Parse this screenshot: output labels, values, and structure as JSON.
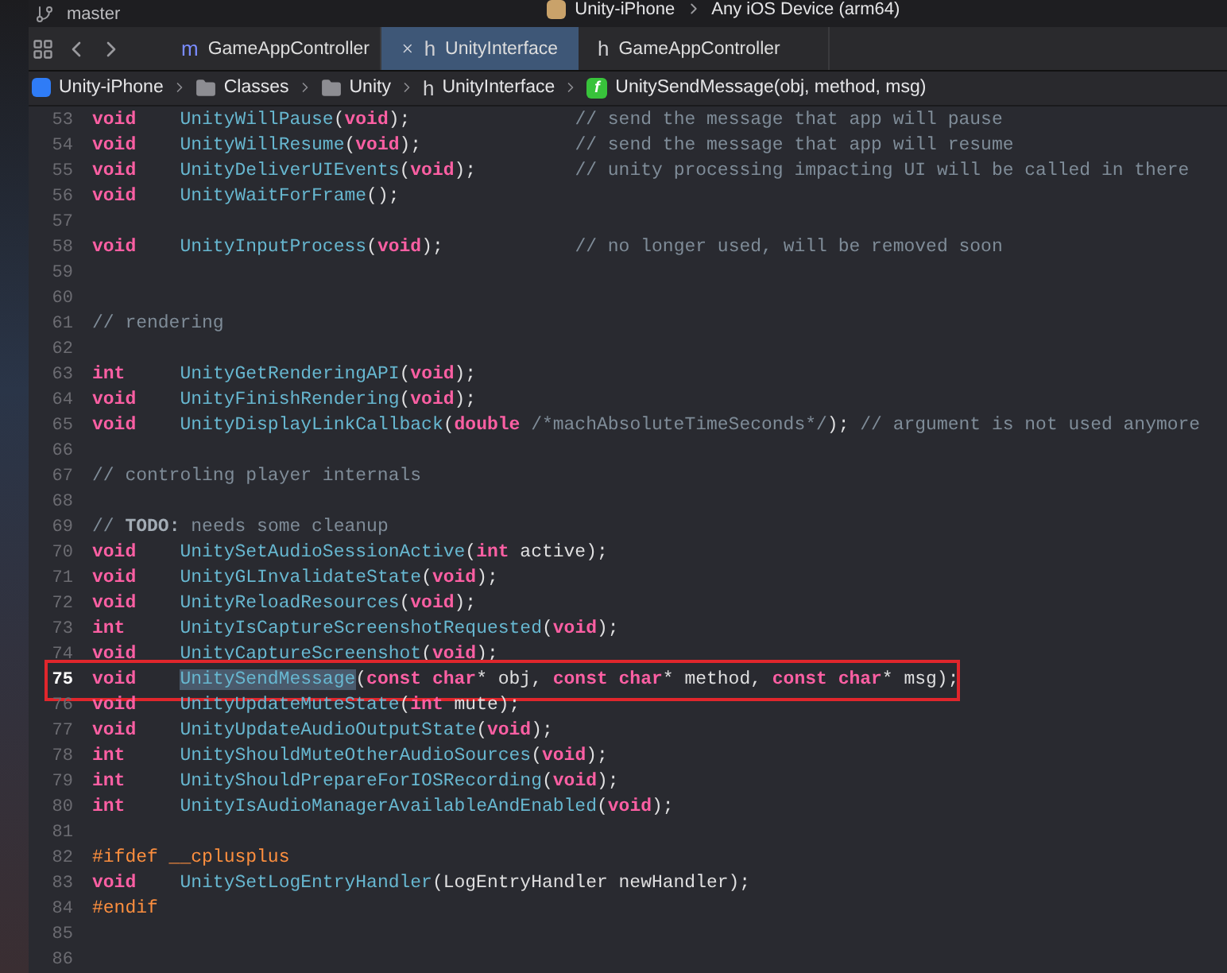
{
  "toolbar": {
    "branch": "master",
    "scheme": "Unity-iPhone",
    "destination": "Any iOS Device (arm64)"
  },
  "tabs": [
    {
      "kind": "source",
      "glyph": "m",
      "label": "GameAppController",
      "selected": false
    },
    {
      "kind": "header",
      "glyph": "h",
      "label": "UnityInterface",
      "selected": true
    },
    {
      "kind": "header",
      "glyph": "h",
      "label": "GameAppController",
      "selected": false
    }
  ],
  "breadcrumbs": [
    {
      "kind": "app",
      "label": "Unity-iPhone"
    },
    {
      "kind": "folder",
      "label": "Classes"
    },
    {
      "kind": "folder",
      "label": "Unity"
    },
    {
      "kind": "header",
      "glyph": "h",
      "label": "UnityInterface"
    },
    {
      "kind": "function",
      "glyph": "f",
      "label": "UnitySendMessage(obj, method, msg)"
    }
  ],
  "lines": [
    {
      "number": "53",
      "highlighted": false,
      "tokens": [
        {
          "kind": "keyword",
          "text": "void"
        },
        {
          "kind": "function",
          "text": "UnityWillPause"
        },
        {
          "kind": "plain",
          "text": "("
        },
        {
          "kind": "keyword",
          "text": "void"
        },
        {
          "kind": "plain",
          "text": ");"
        },
        {
          "kind": "note",
          "text": "// send the message that app will pause"
        }
      ]
    },
    {
      "number": "54",
      "highlighted": false,
      "tokens": [
        {
          "kind": "keyword",
          "text": "void"
        },
        {
          "kind": "function",
          "text": "UnityWillResume"
        },
        {
          "kind": "plain",
          "text": "("
        },
        {
          "kind": "keyword",
          "text": "void"
        },
        {
          "kind": "plain",
          "text": ");"
        },
        {
          "kind": "note",
          "text": "// send the message that app will resume"
        }
      ]
    },
    {
      "number": "55",
      "highlighted": false,
      "tokens": [
        {
          "kind": "keyword",
          "text": "void"
        },
        {
          "kind": "function",
          "text": "UnityDeliverUIEvents"
        },
        {
          "kind": "plain",
          "text": "("
        },
        {
          "kind": "keyword",
          "text": "void"
        },
        {
          "kind": "plain",
          "text": ");"
        },
        {
          "kind": "note",
          "text": "// unity processing impacting UI will be called in there"
        }
      ]
    },
    {
      "number": "56",
      "highlighted": false,
      "tokens": [
        {
          "kind": "keyword",
          "text": "void"
        },
        {
          "kind": "function",
          "text": "UnityWaitForFrame"
        },
        {
          "kind": "plain",
          "text": "();"
        }
      ]
    },
    {
      "number": "57",
      "highlighted": false
    },
    {
      "number": "58",
      "highlighted": false,
      "tokens": [
        {
          "kind": "keyword",
          "text": "void"
        },
        {
          "kind": "function",
          "text": "UnityInputProcess"
        },
        {
          "kind": "plain",
          "text": "("
        },
        {
          "kind": "keyword",
          "text": "void"
        },
        {
          "kind": "plain",
          "text": ");"
        },
        {
          "kind": "note",
          "text": "// no longer used, will be removed soon"
        }
      ]
    },
    {
      "number": "59",
      "highlighted": false
    },
    {
      "number": "60",
      "highlighted": false
    },
    {
      "number": "61",
      "highlighted": false,
      "tokens": [
        {
          "kind": "comment",
          "text": "// rendering"
        }
      ]
    },
    {
      "number": "62",
      "highlighted": false
    },
    {
      "number": "63",
      "highlighted": false,
      "tokens": [
        {
          "kind": "keyword",
          "text": "int"
        },
        {
          "kind": "function",
          "text": "UnityGetRenderingAPI"
        },
        {
          "kind": "plain",
          "text": "("
        },
        {
          "kind": "keyword",
          "text": "void"
        },
        {
          "kind": "plain",
          "text": ");"
        }
      ]
    },
    {
      "number": "64",
      "highlighted": false,
      "tokens": [
        {
          "kind": "keyword",
          "text": "void"
        },
        {
          "kind": "function",
          "text": "UnityFinishRendering"
        },
        {
          "kind": "plain",
          "text": "("
        },
        {
          "kind": "keyword",
          "text": "void"
        },
        {
          "kind": "plain",
          "text": ");"
        }
      ]
    },
    {
      "number": "65",
      "highlighted": false,
      "tokens": [
        {
          "kind": "keyword",
          "text": "void"
        },
        {
          "kind": "function",
          "text": "UnityDisplayLinkCallback"
        },
        {
          "kind": "plain",
          "text": "("
        },
        {
          "kind": "keyword",
          "text": "double "
        },
        {
          "kind": "comment",
          "text": "/*machAbsoluteTimeSeconds*/"
        },
        {
          "kind": "plain",
          "text": ");"
        },
        {
          "kind": "note",
          "text": "// argument is not used anymore"
        }
      ]
    },
    {
      "number": "66",
      "highlighted": false
    },
    {
      "number": "67",
      "highlighted": false,
      "tokens": [
        {
          "kind": "comment",
          "text": "// controling player internals"
        }
      ]
    },
    {
      "number": "68",
      "highlighted": false
    },
    {
      "number": "69",
      "highlighted": false,
      "tokens": [
        {
          "kind": "comment",
          "text": "// "
        },
        {
          "kind": "tag",
          "text": "TODO:"
        },
        {
          "kind": "comment",
          "text": " needs some cleanup"
        }
      ]
    },
    {
      "number": "70",
      "highlighted": false,
      "tokens": [
        {
          "kind": "keyword",
          "text": "void"
        },
        {
          "kind": "function",
          "text": "UnitySetAudioSessionActive"
        },
        {
          "kind": "plain",
          "text": "("
        },
        {
          "kind": "keyword",
          "text": "int "
        },
        {
          "kind": "plain",
          "text": "active);"
        }
      ]
    },
    {
      "number": "71",
      "highlighted": false,
      "tokens": [
        {
          "kind": "keyword",
          "text": "void"
        },
        {
          "kind": "function",
          "text": "UnityGLInvalidateState"
        },
        {
          "kind": "plain",
          "text": "("
        },
        {
          "kind": "keyword",
          "text": "void"
        },
        {
          "kind": "plain",
          "text": ");"
        }
      ]
    },
    {
      "number": "72",
      "highlighted": false,
      "tokens": [
        {
          "kind": "keyword",
          "text": "void"
        },
        {
          "kind": "function",
          "text": "UnityReloadResources"
        },
        {
          "kind": "plain",
          "text": "("
        },
        {
          "kind": "keyword",
          "text": "void"
        },
        {
          "kind": "plain",
          "text": ");"
        }
      ]
    },
    {
      "number": "73",
      "highlighted": false,
      "tokens": [
        {
          "kind": "keyword",
          "text": "int"
        },
        {
          "kind": "function",
          "text": "UnityIsCaptureScreenshotRequested"
        },
        {
          "kind": "plain",
          "text": "("
        },
        {
          "kind": "keyword",
          "text": "void"
        },
        {
          "kind": "plain",
          "text": ");"
        }
      ]
    },
    {
      "number": "74",
      "highlighted": false,
      "tokens": [
        {
          "kind": "keyword",
          "text": "void"
        },
        {
          "kind": "function",
          "text": "UnityCaptureScreenshot"
        },
        {
          "kind": "plain",
          "text": "("
        },
        {
          "kind": "keyword",
          "text": "void"
        },
        {
          "kind": "plain",
          "text": ");"
        }
      ]
    },
    {
      "number": "75",
      "highlighted": true,
      "tokens": [
        {
          "kind": "keyword",
          "text": "void"
        },
        {
          "kind": "selection",
          "text": "UnitySendMessage"
        },
        {
          "kind": "plain",
          "text": "("
        },
        {
          "kind": "keyword",
          "text": "const char"
        },
        {
          "kind": "plain",
          "text": "* obj, "
        },
        {
          "kind": "keyword",
          "text": "const char"
        },
        {
          "kind": "plain",
          "text": "* method, "
        },
        {
          "kind": "keyword",
          "text": "const char"
        },
        {
          "kind": "plain",
          "text": "* msg);"
        }
      ]
    },
    {
      "number": "76",
      "highlighted": false,
      "tokens": [
        {
          "kind": "keyword",
          "text": "void"
        },
        {
          "kind": "function",
          "text": "UnityUpdateMuteState"
        },
        {
          "kind": "plain",
          "text": "("
        },
        {
          "kind": "keyword",
          "text": "int "
        },
        {
          "kind": "plain",
          "text": "mute);"
        }
      ]
    },
    {
      "number": "77",
      "highlighted": false,
      "tokens": [
        {
          "kind": "keyword",
          "text": "void"
        },
        {
          "kind": "function",
          "text": "UnityUpdateAudioOutputState"
        },
        {
          "kind": "plain",
          "text": "("
        },
        {
          "kind": "keyword",
          "text": "void"
        },
        {
          "kind": "plain",
          "text": ");"
        }
      ]
    },
    {
      "number": "78",
      "highlighted": false,
      "tokens": [
        {
          "kind": "keyword",
          "text": "int"
        },
        {
          "kind": "function",
          "text": "UnityShouldMuteOtherAudioSources"
        },
        {
          "kind": "plain",
          "text": "("
        },
        {
          "kind": "keyword",
          "text": "void"
        },
        {
          "kind": "plain",
          "text": ");"
        }
      ]
    },
    {
      "number": "79",
      "highlighted": false,
      "tokens": [
        {
          "kind": "keyword",
          "text": "int"
        },
        {
          "kind": "function",
          "text": "UnityShouldPrepareForIOSRecording"
        },
        {
          "kind": "plain",
          "text": "("
        },
        {
          "kind": "keyword",
          "text": "void"
        },
        {
          "kind": "plain",
          "text": ");"
        }
      ]
    },
    {
      "number": "80",
      "highlighted": false,
      "tokens": [
        {
          "kind": "keyword",
          "text": "int"
        },
        {
          "kind": "function",
          "text": "UnityIsAudioManagerAvailableAndEnabled"
        },
        {
          "kind": "plain",
          "text": "("
        },
        {
          "kind": "keyword",
          "text": "void"
        },
        {
          "kind": "plain",
          "text": ");"
        }
      ]
    },
    {
      "number": "81",
      "highlighted": false
    },
    {
      "number": "82",
      "highlighted": false,
      "tokens": [
        {
          "kind": "directive",
          "text": "#ifdef __cplusplus"
        }
      ]
    },
    {
      "number": "83",
      "highlighted": false,
      "tokens": [
        {
          "kind": "keyword",
          "text": "void"
        },
        {
          "kind": "function",
          "text": "UnitySetLogEntryHandler"
        },
        {
          "kind": "plain",
          "text": "(LogEntryHandler newHandler);"
        }
      ]
    },
    {
      "number": "84",
      "highlighted": false,
      "tokens": [
        {
          "kind": "directive",
          "text": "#endif"
        }
      ]
    },
    {
      "number": "85",
      "highlighted": false
    },
    {
      "number": "86",
      "highlighted": false
    }
  ]
}
